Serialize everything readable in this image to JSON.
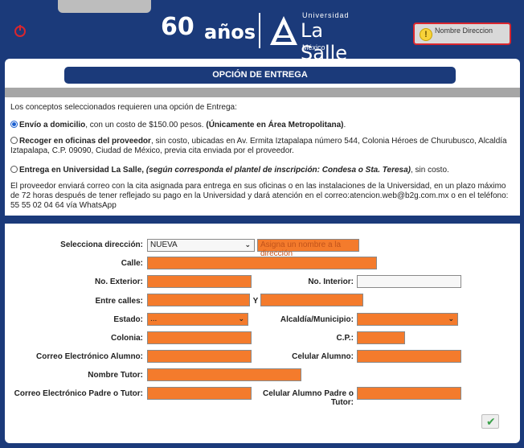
{
  "header": {
    "logo_number": "60",
    "logo_text": "años",
    "university_small": "Universidad",
    "university_name": "La Salle",
    "university_country": "México",
    "user_name": "Nombre Direccion"
  },
  "page": {
    "title": "OPCIÓN DE ENTREGA",
    "intro": "Los conceptos seleccionados requieren una opción de Entrega:"
  },
  "options": [
    {
      "selected": true,
      "label_bold": "Envío a domicilio",
      "text": ", con un costo de $150.00 pesos. ",
      "note_bold": "(Únicamente en Área Metropolitana)",
      "tail": "."
    },
    {
      "selected": false,
      "label_bold": "Recoger en oficinas del proveedor",
      "text": ", sin costo, ubicadas en Av. Ermita Iztapalapa número 544, Colonia Héroes de Churubusco, Alcaldía Iztapalapa, C.P. 09090, Ciudad de México, previa cita enviada por el proveedor."
    },
    {
      "selected": false,
      "label_bold": "Entrega en Universidad La Salle, ",
      "note_bolditalic": "(según corresponda el plantel de inscripción: Condesa o Sta. Teresa)",
      "text": ", sin costo."
    }
  ],
  "provider_note": "El proveedor enviará correo con la cita asignada para entrega en sus oficinas o en las instalaciones de la Universidad, en un plazo máximo de 72 horas después de tener reflejado su pago en la Universidad y dará atención en el correo:atencion.web@b2g.com.mx o en el teléfono: 55 55 02 04 64 vía WhatsApp",
  "form": {
    "select_address_label": "Selecciona dirección:",
    "select_address_value": "NUEVA",
    "address_name_placeholder": "Asigna un nombre a la dirección",
    "street_label": "Calle:",
    "ext_number_label": "No. Exterior:",
    "int_number_label": "No. Interior:",
    "between_streets_label": "Entre calles:",
    "between_and": "Y",
    "state_label": "Estado:",
    "state_value": "...",
    "municipality_label": "Alcaldía/Municipio:",
    "colony_label": "Colonia:",
    "zip_label": "C.P.:",
    "student_email_label": "Correo Electrónico Alumno:",
    "student_phone_label": "Celular Alumno:",
    "tutor_name_label": "Nombre Tutor:",
    "tutor_email_label": "Correo Electrónico Padre o Tutor:",
    "tutor_phone_label": "Celular Alumno Padre o Tutor:"
  },
  "colors": {
    "navy": "#1b3a7a",
    "field_orange": "#f47b2c",
    "alert_red": "#d9262e"
  },
  "icons": [
    "power-icon",
    "warning-icon",
    "chevron-down-icon",
    "checkmark-icon"
  ]
}
